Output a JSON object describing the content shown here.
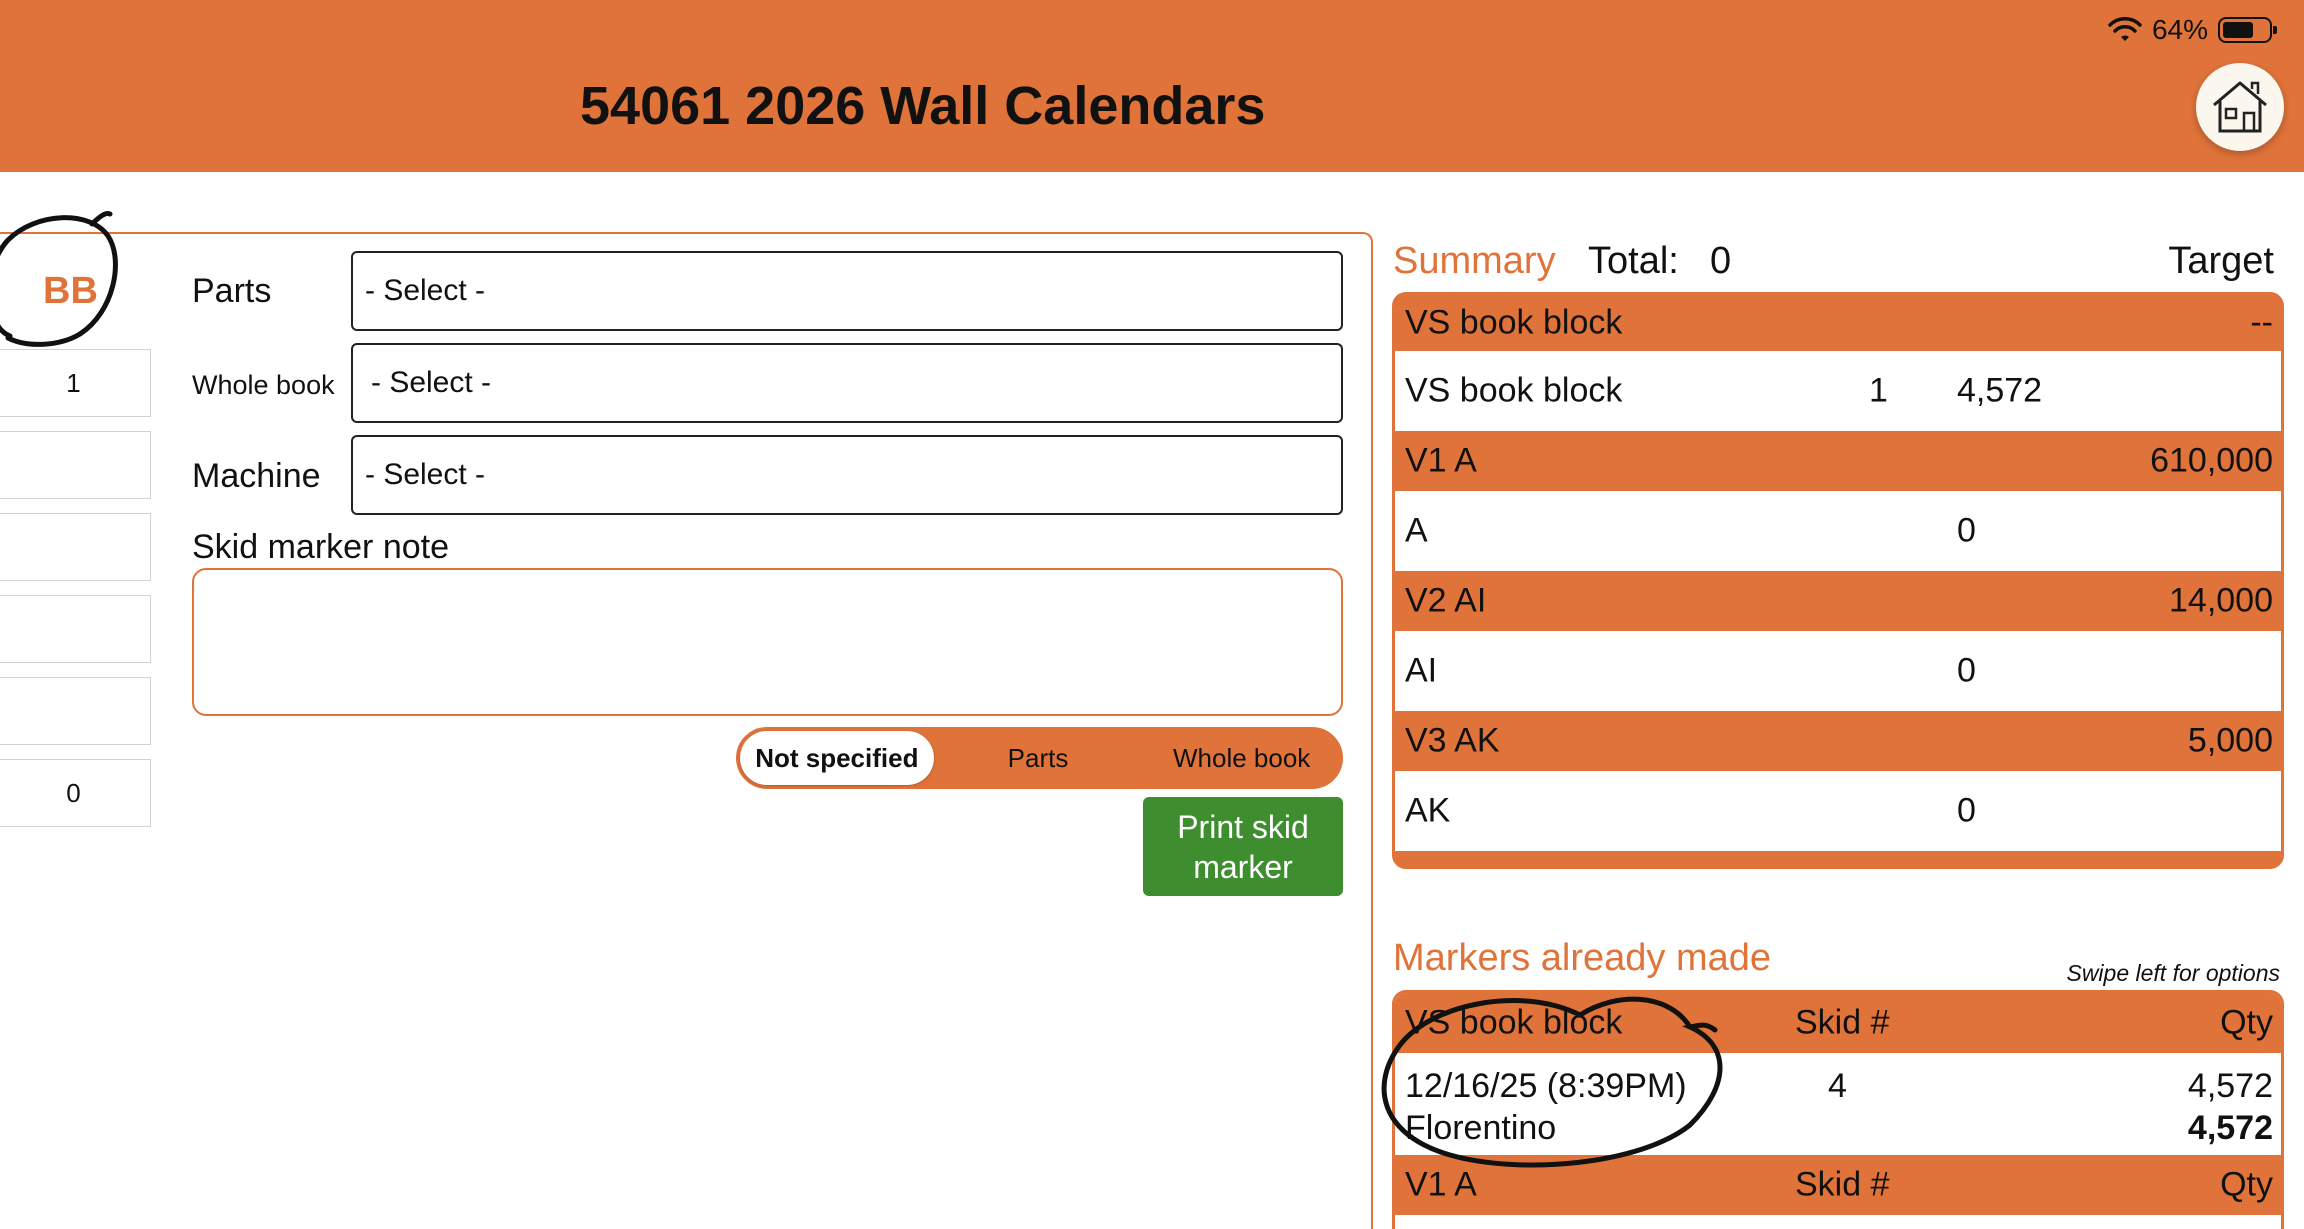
{
  "status_bar": {
    "battery_percent": "64%",
    "battery_level": 0.64
  },
  "header": {
    "title": "54061 2026 Wall Calendars"
  },
  "left_panel": {
    "badge": "BB",
    "side_values": [
      "1",
      "",
      "",
      "",
      "",
      "0"
    ]
  },
  "form": {
    "parts_label": "Parts",
    "parts_value": "- Select -",
    "whole_book_label": "Whole book",
    "whole_book_value": "- Select -",
    "machine_label": "Machine",
    "machine_value": "- Select -",
    "note_label": "Skid marker note",
    "note_value": "",
    "segments": [
      "Not specified",
      "Parts",
      "Whole book"
    ],
    "selected_segment": "Not specified",
    "print_button": "Print skid marker"
  },
  "summary": {
    "title": "Summary",
    "total_label": "Total:",
    "total_value": "0",
    "target_label": "Target",
    "groups": [
      {
        "name": "VS book block",
        "target": "--",
        "rows": [
          {
            "name": "VS book block",
            "count": "1",
            "qty": "4,572"
          }
        ]
      },
      {
        "name": "V1 A",
        "target": "610,000",
        "rows": [
          {
            "name": "A",
            "count": "",
            "qty": "0"
          }
        ]
      },
      {
        "name": "V2 AI",
        "target": "14,000",
        "rows": [
          {
            "name": "AI",
            "count": "",
            "qty": "0"
          }
        ]
      },
      {
        "name": "V3 AK",
        "target": "5,000",
        "rows": [
          {
            "name": "AK",
            "count": "",
            "qty": "0"
          }
        ]
      }
    ]
  },
  "markers": {
    "title": "Markers already made",
    "hint": "Swipe left for options",
    "groups": [
      {
        "name": "VS book block",
        "skid_header": "Skid #",
        "qty_header": "Qty",
        "entries": [
          {
            "date": "12/16/25 (8:39PM)",
            "user": "Florentino",
            "skid": "4",
            "qty": "4,572",
            "total": "4,572"
          }
        ]
      },
      {
        "name": "V1 A",
        "skid_header": "Skid #",
        "qty_header": "Qty",
        "entries": []
      }
    ]
  },
  "colors": {
    "accent": "#e0733a",
    "print_button": "#3e8e2f"
  }
}
